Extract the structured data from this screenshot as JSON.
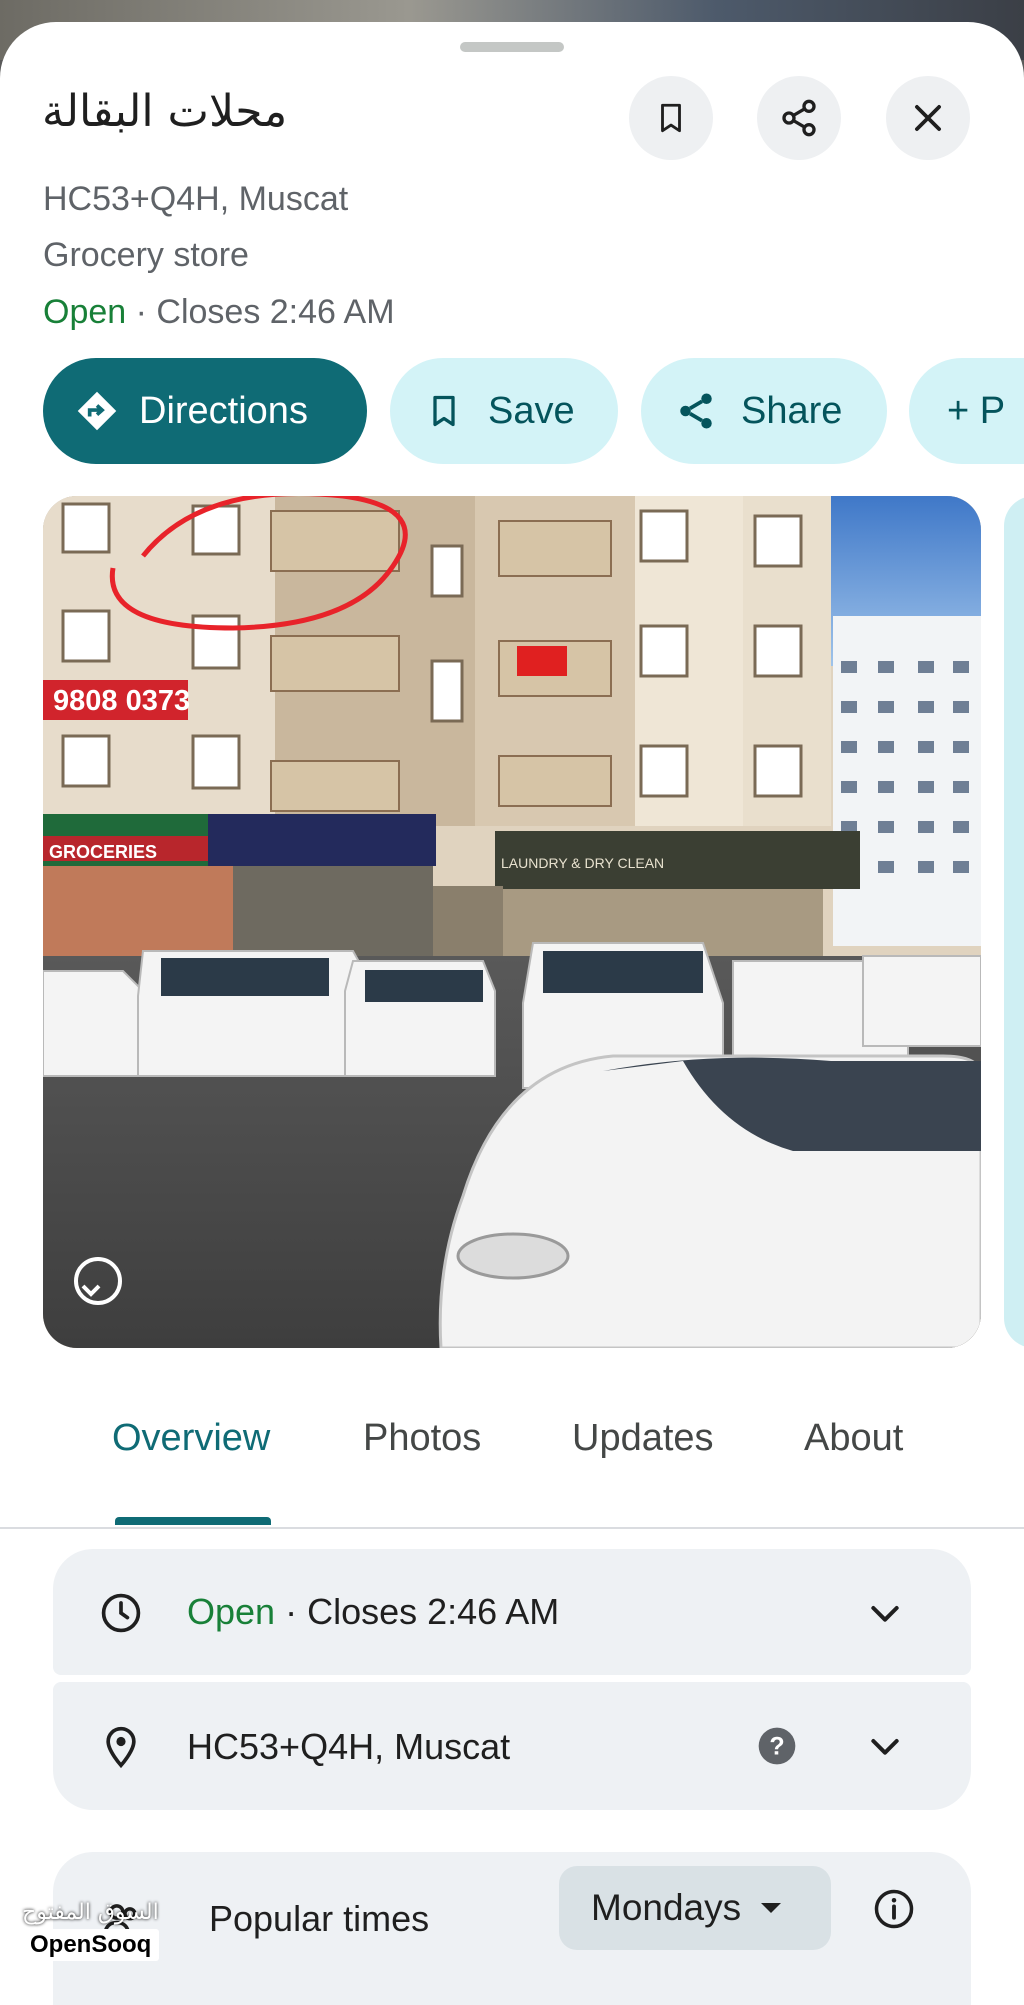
{
  "place": {
    "name": "محلات البقالة",
    "plus_code": "HC53+Q4H, Muscat",
    "category": "Grocery store",
    "status": "Open",
    "hours_suffix": " · Closes 2:46 AM"
  },
  "header_buttons": {
    "save_icon": "bookmark-icon",
    "share_icon": "share-icon",
    "close_icon": "close-icon"
  },
  "actions": {
    "directions": "Directions",
    "save": "Save",
    "share": "Share",
    "more": "+ P"
  },
  "photo": {
    "sign_phone": "9808 0373",
    "sign_groceries": "GROCERIES",
    "sign_laundry": "LAUNDRY & DRY CLEAN"
  },
  "tabs": [
    {
      "label": "Overview"
    },
    {
      "label": "Photos"
    },
    {
      "label": "Updates"
    },
    {
      "label": "About"
    }
  ],
  "details": {
    "hours_status": "Open",
    "hours_text": " · Closes 2:46 AM",
    "address": "HC53+Q4H, Muscat",
    "popular_times_label": "Popular times",
    "day_selector": "Mondays"
  },
  "watermark": {
    "arabic": "السوق المفتوح",
    "brand": "OpenSooq"
  },
  "colors": {
    "accent": "#0f6b75",
    "open_green": "#188038",
    "chip_bg": "#d3f3f7",
    "card_bg": "#eef1f4"
  }
}
